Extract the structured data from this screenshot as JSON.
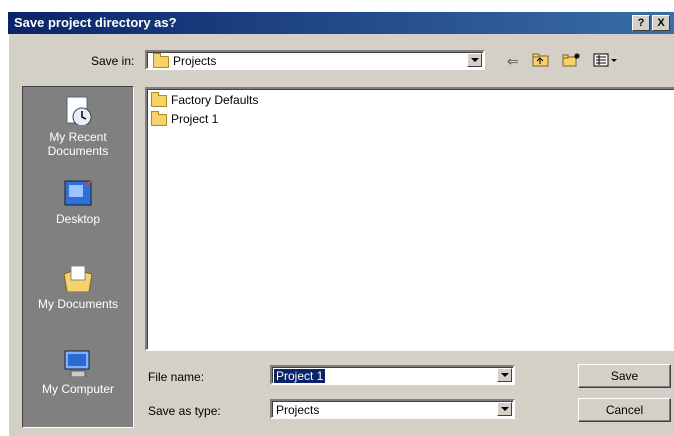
{
  "window": {
    "title": "Save project directory as?",
    "help_label": "?",
    "close_label": "X"
  },
  "save_in": {
    "label": "Save in:",
    "value": "Projects"
  },
  "places": [
    {
      "label": "My Recent Documents"
    },
    {
      "label": "Desktop"
    },
    {
      "label": "My Documents"
    },
    {
      "label": "My Computer"
    }
  ],
  "files": [
    {
      "name": "Factory Defaults"
    },
    {
      "name": "Project 1"
    }
  ],
  "file_name": {
    "label": "File name:",
    "value": "Project 1"
  },
  "save_as_type": {
    "label": "Save as type:",
    "value": "Projects"
  },
  "buttons": {
    "save": "Save",
    "cancel": "Cancel"
  }
}
